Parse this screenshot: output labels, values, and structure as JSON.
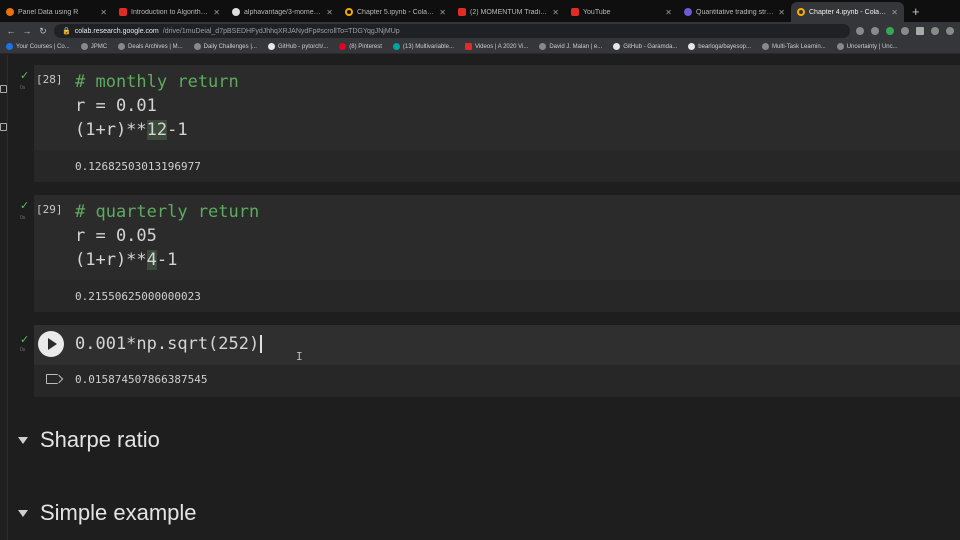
{
  "tabs": [
    {
      "label": "Panel Data using R",
      "icon": "orange-circle-icon",
      "active": false
    },
    {
      "label": "Introduction to Algorithmic",
      "icon": "youtube-icon",
      "active": false
    },
    {
      "label": "alphavantage/3-momentum",
      "icon": "github-icon",
      "active": false
    },
    {
      "label": "Chapter 5.ipynb - Colabora",
      "icon": "colab-icon",
      "active": false
    },
    {
      "label": "(2) MOMENTUM Trading St",
      "icon": "youtube-icon",
      "active": false
    },
    {
      "label": "YouTube",
      "icon": "youtube-icon",
      "active": false
    },
    {
      "label": "Quantitative trading strateg",
      "icon": "purple-circle-icon",
      "active": false
    },
    {
      "label": "Chapter 4.ipynb - Colabora",
      "icon": "colab-icon",
      "active": true
    }
  ],
  "address": {
    "host": "colab.research.google.com",
    "path": "/drive/1muDeial_d7pBSEDHFydJhhqXRJANydFp#scrollTo=TDGYqgJNjMUp"
  },
  "bookmarks": [
    "Your Courses | Co...",
    "JPMC",
    "Deals Archives | M...",
    "Daily Challenges |...",
    "GitHub - pytorch/...",
    "(8) Pinterest",
    "(13) Multivariable...",
    "Videos | A 2020 Vi...",
    "David J. Malan | e...",
    "GitHub - Garamda...",
    "bearloga/bayesop...",
    "Multi-Task Learnin...",
    "Uncertainty | Unc..."
  ],
  "cells": [
    {
      "count": "[28]",
      "comment": "# monthly return",
      "line2": "r = 0.01",
      "line3_pre": "(1+r)**",
      "line3_hl": "12",
      "line3_post": "-1",
      "output": "0.12682503013196977"
    },
    {
      "count": "[29]",
      "comment": "# quarterly return",
      "line2": "r = 0.05",
      "line3_pre": "(1+r)**",
      "line3_hl": "4",
      "line3_post": "-1",
      "output": "0.21550625000000023"
    }
  ],
  "active_cell": {
    "code": "0.001*np.sqrt(252)",
    "output": "0.015874507866387545"
  },
  "sections": {
    "sharpe": "Sharpe ratio",
    "simple": "Simple example"
  },
  "duration": "0s"
}
